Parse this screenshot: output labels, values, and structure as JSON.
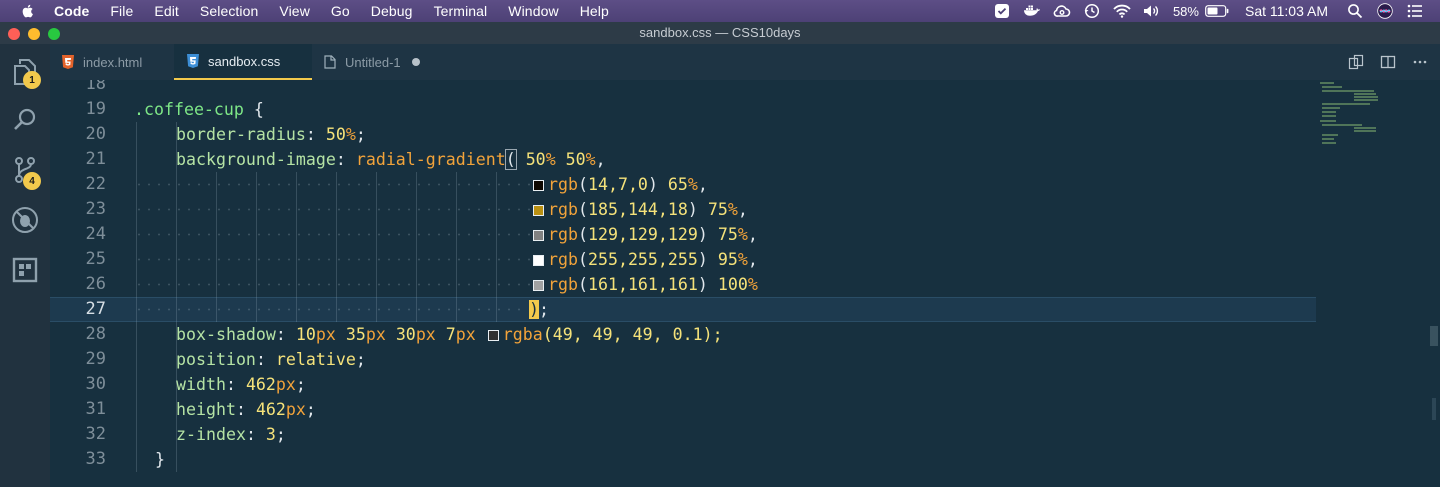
{
  "menubar": {
    "app_name": "Code",
    "items": [
      "File",
      "Edit",
      "Selection",
      "View",
      "Go",
      "Debug",
      "Terminal",
      "Window",
      "Help"
    ],
    "battery_percent": "58%",
    "clock": "Sat 11:03 AM"
  },
  "window": {
    "title": "sandbox.css — CSS10days"
  },
  "activitybar": {
    "explorer_badge": "1",
    "scm_badge": "4"
  },
  "tabs": [
    {
      "label": "index.html",
      "icon": "html5-icon",
      "active": false
    },
    {
      "label": "sandbox.css",
      "icon": "css3-icon",
      "active": true
    },
    {
      "label": "Untitled-1",
      "icon": "file-icon",
      "active": false,
      "dirty": true
    }
  ],
  "editor": {
    "line_numbers": [
      "18",
      "19",
      "20",
      "21",
      "22",
      "23",
      "24",
      "25",
      "26",
      "27",
      "28",
      "29",
      "30",
      "31",
      "32",
      "33"
    ],
    "current_line": "27",
    "code": {
      "l19": [
        ".coffee-cup",
        " {"
      ],
      "l20": [
        "border-radius",
        ": ",
        "50",
        "%",
        ";"
      ],
      "l21": [
        "background-image",
        ": ",
        "radial-gradient",
        "(",
        " 50",
        "%",
        " 50",
        "%",
        ","
      ],
      "l22": [
        "rgb",
        "(",
        "14,7,0",
        ") ",
        "65",
        "%",
        ","
      ],
      "l23": [
        "rgb",
        "(",
        "185,144,18",
        ") ",
        "75",
        "%",
        ","
      ],
      "l24": [
        "rgb",
        "(",
        "129,129,129",
        ") ",
        "75",
        "%",
        ","
      ],
      "l25": [
        "rgb",
        "(",
        "255,255,255",
        ") ",
        "95",
        "%",
        ","
      ],
      "l26": [
        "rgb",
        "(",
        "161,161,161",
        ") ",
        "100",
        "%"
      ],
      "l27": [
        ")",
        ";"
      ],
      "l28": [
        "box-shadow",
        ": ",
        "10",
        "px",
        " 35",
        "px",
        " 30",
        "px",
        " 7",
        "px",
        " ",
        "rgba",
        "(49, 49, 49, 0.1);"
      ],
      "l29": [
        "position",
        ": ",
        "relative",
        ";"
      ],
      "l30": [
        "width",
        ": ",
        "462",
        "px",
        ";"
      ],
      "l31": [
        "height",
        ": ",
        "462",
        "px",
        ";"
      ],
      "l32": [
        "z-index",
        ": ",
        "3",
        ";"
      ],
      "l33": [
        "}"
      ]
    },
    "swatch_colors": [
      "#0e0700",
      "#b99012",
      "#818181",
      "#ffffff",
      "#a1a1a1",
      "#313131"
    ]
  },
  "colors": {
    "editor_bg": "#17303f",
    "accent": "#f2c94c",
    "selector": "#7ee787",
    "property": "#b5e3a4",
    "function": "#f2a33a",
    "number": "#f5e27a"
  }
}
